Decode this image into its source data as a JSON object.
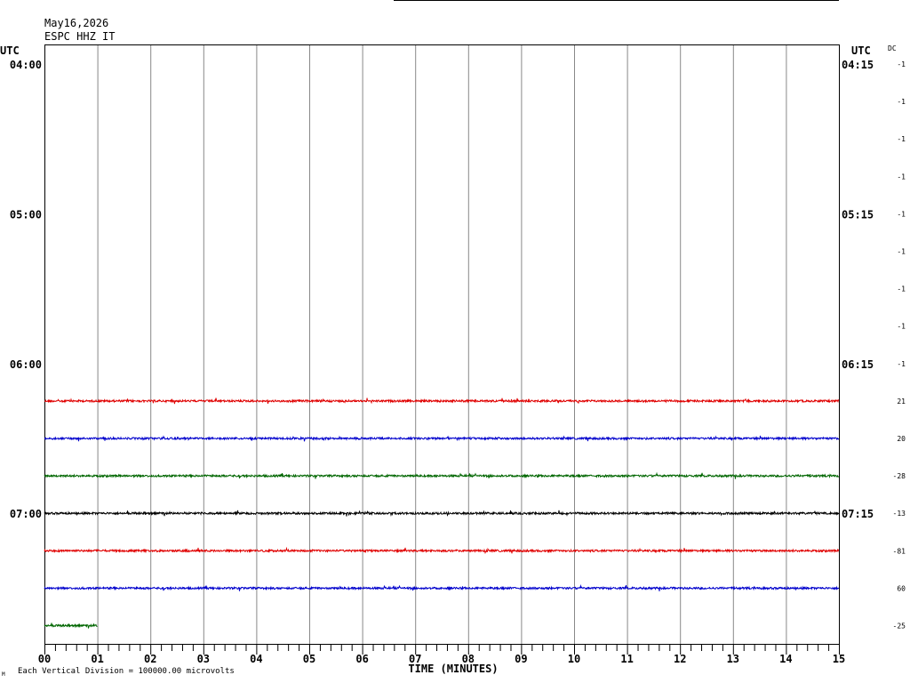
{
  "chart_data": {
    "type": "line",
    "header": {
      "date": "May16,2026",
      "station": "ESPC HHZ IT"
    },
    "left_axis_title": "UTC",
    "right_axis_title": "UTC",
    "dc_label": "DC",
    "xlabel": "TIME (MINUTES)",
    "xlim": [
      0,
      15
    ],
    "x_ticks": [
      "00",
      "01",
      "02",
      "03",
      "04",
      "05",
      "06",
      "07",
      "08",
      "09",
      "10",
      "11",
      "12",
      "13",
      "14",
      "15"
    ],
    "footer_note": "Each Vertical Division = 100000.00 microvolts",
    "footer_mark": "M",
    "left_times": [
      {
        "row": 0,
        "label": "04:00"
      },
      {
        "row": 4,
        "label": "05:00"
      },
      {
        "row": 8,
        "label": "06:00"
      },
      {
        "row": 12,
        "label": "07:00"
      }
    ],
    "right_times": [
      {
        "row": 0,
        "label": "04:15"
      },
      {
        "row": 4,
        "label": "05:15"
      },
      {
        "row": 8,
        "label": "06:15"
      },
      {
        "row": 12,
        "label": "07:15"
      }
    ],
    "dc_offsets": [
      "-1",
      "-1",
      "-1",
      "-1",
      "-1",
      "-1",
      "-1",
      "-1",
      "-1",
      "21",
      "20",
      "-28",
      "-13",
      "-81",
      "60",
      "-25"
    ],
    "colors": {
      "red": "#e00000",
      "blue": "#0000cc",
      "green": "#006600",
      "black": "#000000",
      "grid": "#888888"
    },
    "traces": [
      {
        "row": 9,
        "color": "#e00000",
        "start_min": 0,
        "end_min": 15
      },
      {
        "row": 10,
        "color": "#0000cc",
        "start_min": 0,
        "end_min": 15
      },
      {
        "row": 11,
        "color": "#006600",
        "start_min": 0,
        "end_min": 15
      },
      {
        "row": 12,
        "color": "#000000",
        "start_min": 0,
        "end_min": 15
      },
      {
        "row": 13,
        "color": "#e00000",
        "start_min": 0,
        "end_min": 15
      },
      {
        "row": 14,
        "color": "#0000cc",
        "start_min": 0,
        "end_min": 15
      },
      {
        "row": 15,
        "color": "#006600",
        "start_min": 0,
        "end_min": 1
      }
    ]
  }
}
